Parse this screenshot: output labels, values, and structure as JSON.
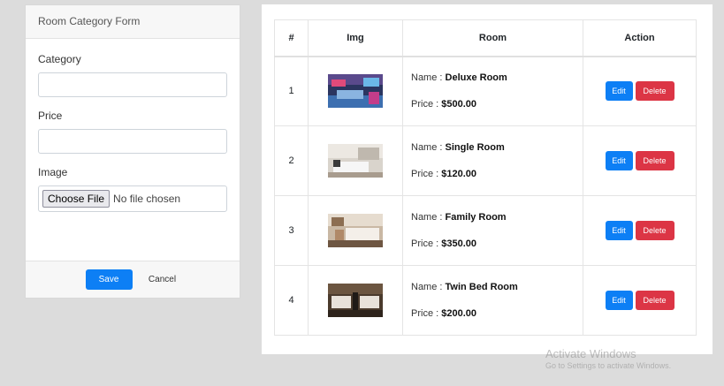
{
  "form": {
    "title": "Room Category Form",
    "category_label": "Category",
    "category_value": "",
    "price_label": "Price",
    "price_value": "",
    "image_label": "Image",
    "choose_file_label": "Choose File",
    "file_status": "No file chosen",
    "save_label": "Save",
    "cancel_label": "Cancel"
  },
  "table": {
    "headers": [
      "#",
      "Img",
      "Room",
      "Action"
    ],
    "name_prefix": "Name : ",
    "price_prefix": "Price : ",
    "edit_label": "Edit",
    "delete_label": "Delete",
    "rows": [
      {
        "num": "1",
        "name": "Deluxe Room",
        "price": "$500.00",
        "thumb": "deluxe"
      },
      {
        "num": "2",
        "name": "Single Room",
        "price": "$120.00",
        "thumb": "single"
      },
      {
        "num": "3",
        "name": "Family Room",
        "price": "$350.00",
        "thumb": "family"
      },
      {
        "num": "4",
        "name": "Twin Bed Room",
        "price": "$200.00",
        "thumb": "twin"
      }
    ]
  },
  "watermark": {
    "title": "Activate Windows",
    "subtitle": "Go to Settings to activate Windows."
  },
  "colors": {
    "primary": "#0d7ff5",
    "danger": "#dc3545"
  }
}
